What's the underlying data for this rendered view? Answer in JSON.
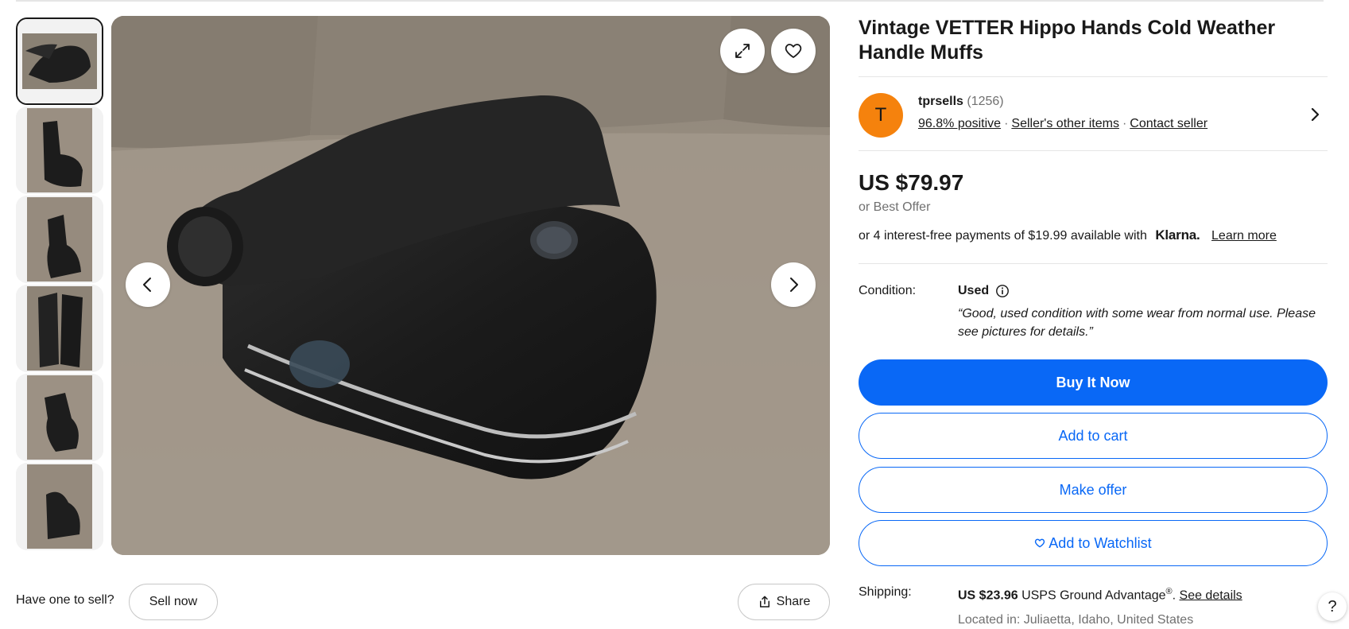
{
  "gallery": {
    "thumbnails": [
      {
        "alt": "",
        "active": true
      },
      {
        "alt": "",
        "active": false
      },
      {
        "alt": "",
        "active": false
      },
      {
        "alt": "",
        "active": false
      },
      {
        "alt": "",
        "active": false
      },
      {
        "alt": "",
        "active": false
      }
    ],
    "expand_icon": "expand-icon",
    "heart_icon": "heart-icon",
    "prev_icon": "chevron-left-icon",
    "next_icon": "chevron-right-icon"
  },
  "sell_prompt": {
    "text": "Have one to sell?",
    "sell_now_label": "Sell now",
    "share_label": "Share"
  },
  "listing": {
    "title": "Vintage VETTER Hippo Hands Cold Weather Handle Muffs",
    "seller": {
      "avatar_letter": "T",
      "avatar_color": "#f5820d",
      "name": "tprsells",
      "feedback_count": "(1256)",
      "positive": "96.8% positive",
      "other_items": "Seller's other items",
      "contact": "Contact seller"
    },
    "price": "US $79.97",
    "best_offer": "or Best Offer",
    "installments": {
      "text": "or 4 interest-free payments of $19.99 available with",
      "provider": "Klarna.",
      "learn_more": "Learn more"
    },
    "condition": {
      "label": "Condition:",
      "value": "Used",
      "quote": "“Good, used condition with some wear from normal use. Please see pictures for details.”"
    },
    "buttons": {
      "buy_now": "Buy It Now",
      "add_to_cart": "Add to cart",
      "make_offer": "Make offer",
      "watchlist": "Add to Watchlist"
    },
    "shipping": {
      "label": "Shipping:",
      "cost": "US $23.96",
      "service": "USPS Ground Advantage",
      "registered": "®",
      "see_details": "See details",
      "located": "Located in: Juliaetta, Idaho, United States"
    }
  },
  "help_label": "?",
  "colors": {
    "primary_blue": "#0968f6",
    "text": "#191919",
    "muted": "#707070"
  }
}
